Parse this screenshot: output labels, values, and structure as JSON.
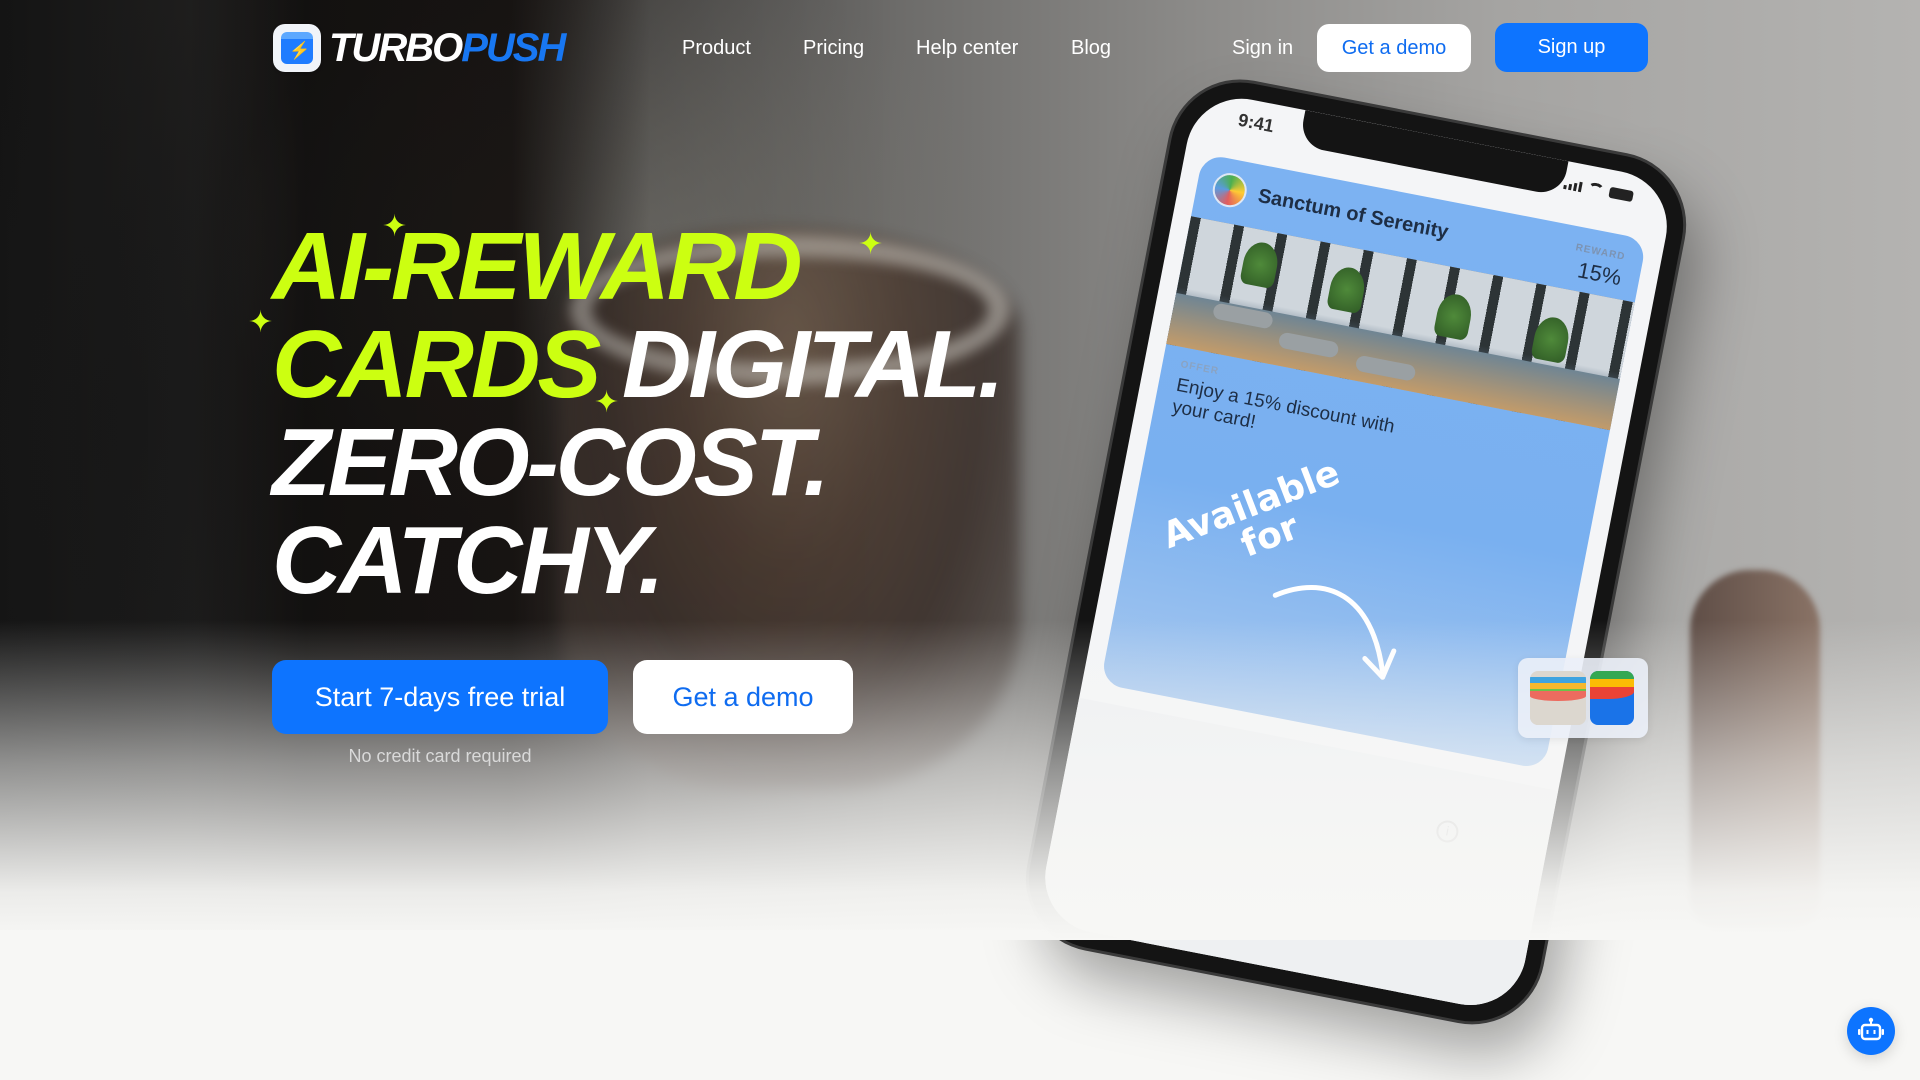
{
  "brand": {
    "name_part1": "TURBO",
    "name_part2": "PUSH",
    "icon": "lightning-bolt-icon",
    "accent_color": "#0d74ff",
    "highlight_color": "#ccff11"
  },
  "nav": {
    "links": [
      {
        "label": "Product"
      },
      {
        "label": "Pricing"
      },
      {
        "label": "Help center"
      },
      {
        "label": "Blog"
      }
    ],
    "sign_in": "Sign in",
    "get_demo": "Get a demo",
    "sign_up": "Sign up"
  },
  "hero": {
    "line1": "AI-REWARD",
    "line2_highlight": "CARDS",
    "line2_rest": "DIGITAL.",
    "line3": "ZERO-COST.",
    "line4": "CATCHY.",
    "cta_primary": "Start 7-days free trial",
    "cta_secondary": "Get a demo",
    "cta_note": "No credit card required"
  },
  "phone": {
    "time": "9:41",
    "pass": {
      "business_name": "Sanctum of Serenity",
      "reward_label": "REWARD",
      "reward_value": "15%",
      "offer_label": "OFFER",
      "offer_text": "Enjoy a 15% discount with your card!"
    },
    "annotation_line1": "Available",
    "annotation_line2": "for",
    "wallet_icons": [
      "apple-wallet-icon",
      "google-wallet-icon"
    ]
  },
  "chatbot": {
    "icon": "robot-icon"
  }
}
